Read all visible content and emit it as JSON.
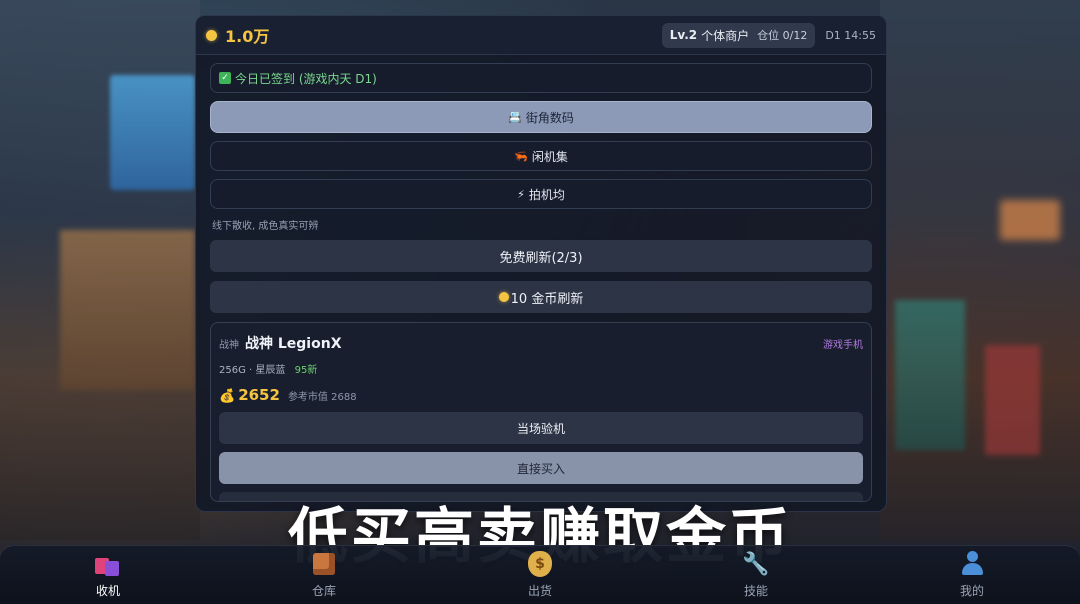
{
  "header": {
    "gold": "1.0万",
    "level": "Lv.2",
    "title": "个体商户",
    "slots": "仓位 0/12",
    "day_time": "D1 14:55"
  },
  "checkin": {
    "text": "今日已签到 (游戏内天 D1)"
  },
  "markets": [
    {
      "icon": "📇",
      "label": "街角数码",
      "active": true
    },
    {
      "icon": "🦐",
      "label": "闲机集",
      "active": false
    },
    {
      "icon": "⚡",
      "label": "拍机均",
      "active": false
    }
  ],
  "hint": "线下散收, 成色真实可辨",
  "refresh": {
    "free_label": "免费刷新(2/3)",
    "paid_label": "10 金币刷新"
  },
  "item": {
    "brand": "战神",
    "name": "战神 LegionX",
    "category": "游戏手机",
    "storage": "256G",
    "color": "星辰蓝",
    "condition": "95新",
    "price": "2652",
    "ref_price": "参考市值 2688",
    "inspect_label": "当场验机",
    "buy_label": "直接买入"
  },
  "caption": "低买高卖赚取金币",
  "nav": [
    {
      "label": "收机",
      "icon": "shopping-bags-icon"
    },
    {
      "label": "仓库",
      "icon": "package-icon"
    },
    {
      "label": "出货",
      "icon": "money-bag-icon"
    },
    {
      "label": "技能",
      "icon": "wrench-icon"
    },
    {
      "label": "我的",
      "icon": "user-icon"
    }
  ],
  "colors": {
    "gold": "#f5c542",
    "accent_active": "#8c9ab8",
    "condition": "#6ad16e",
    "category": "#b07be0"
  }
}
